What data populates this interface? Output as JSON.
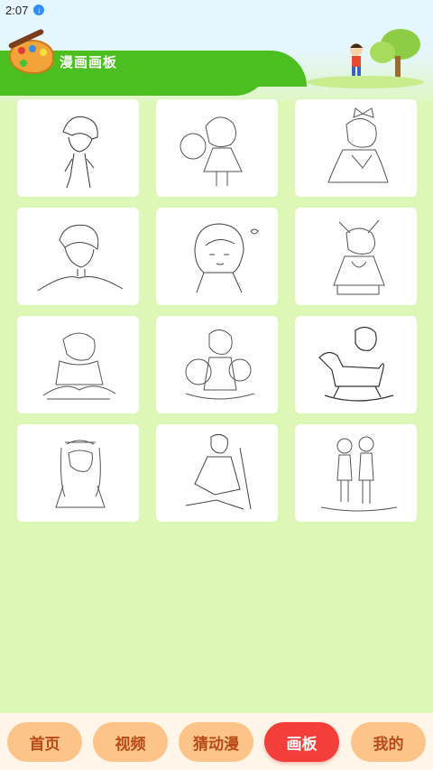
{
  "status": {
    "time": "2:07",
    "download_icon": "download-icon"
  },
  "header": {
    "title": "漫画画板",
    "logo_icon": "palette-icon"
  },
  "gallery": {
    "items": [
      "sketch-boy-standing",
      "sketch-girl-balloon",
      "sketch-girl-bow",
      "sketch-boy-portrait",
      "sketch-girl-portrait",
      "sketch-girl-kimono",
      "sketch-boy-scarf",
      "sketch-boy-with-pet",
      "sketch-kid-rocking-horse",
      "sketch-girl-long-hair",
      "sketch-man-sword",
      "sketch-couple"
    ]
  },
  "tabs": [
    {
      "label": "首页",
      "active": false
    },
    {
      "label": "视频",
      "active": false
    },
    {
      "label": "猜动漫",
      "active": false
    },
    {
      "label": "画板",
      "active": true
    },
    {
      "label": "我的",
      "active": false
    }
  ],
  "colors": {
    "accent": "#f43e3a",
    "tab": "#fdc48a",
    "background": "#ddf7b6",
    "header_green": "#4bbf1f"
  }
}
